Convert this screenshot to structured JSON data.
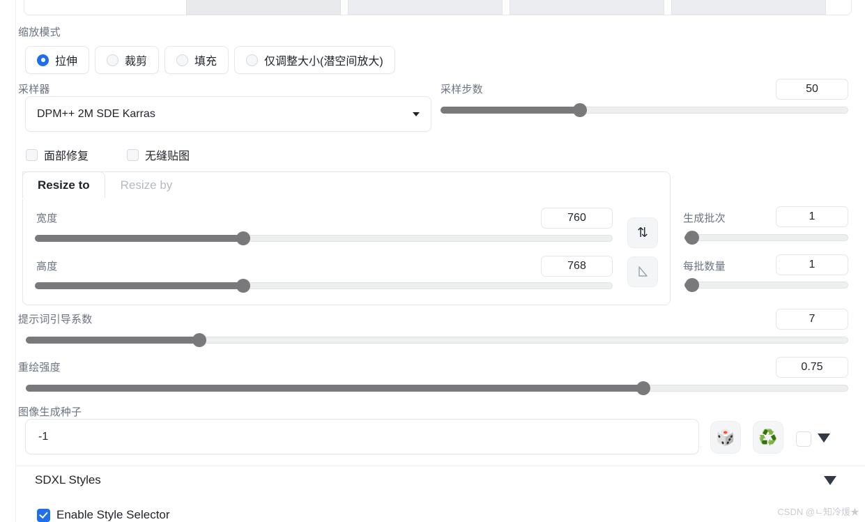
{
  "panel": {
    "resize_mode": {
      "label": "缩放模式",
      "options": [
        {
          "label": "拉伸",
          "selected": true
        },
        {
          "label": "裁剪",
          "selected": false
        },
        {
          "label": "填充",
          "selected": false
        },
        {
          "label": "仅调整大小(潜空间放大)",
          "selected": false
        }
      ]
    },
    "sampler": {
      "label": "采样器",
      "value": "DPM++ 2M SDE Karras",
      "caret_icon": "chevron-down-icon"
    },
    "steps": {
      "label": "采样步数",
      "value": "50",
      "fill_percent": 34
    },
    "toggles": [
      {
        "label": "面部修复",
        "checked": false
      },
      {
        "label": "无缝贴图",
        "checked": false
      }
    ],
    "resize_tabs": [
      {
        "label": "Resize to",
        "active": true
      },
      {
        "label": "Resize by",
        "active": false
      }
    ],
    "width": {
      "label": "宽度",
      "value": "760",
      "fill_percent": 36
    },
    "height": {
      "label": "高度",
      "value": "768",
      "fill_percent": 36
    },
    "swap_button": {
      "icon": "swap-vertical-icon",
      "glyph": "⇅"
    },
    "ratio_button": {
      "icon": "aspect-ratio-triangle-icon"
    },
    "batch_count": {
      "label": "生成批次",
      "value": "1",
      "fill_percent": 0
    },
    "batch_size": {
      "label": "每批数量",
      "value": "1",
      "fill_percent": 0
    },
    "cfg_scale": {
      "label": "提示词引导系数",
      "value": "7",
      "fill_percent": 21
    },
    "denoising": {
      "label": "重绘强度",
      "value": "0.75",
      "fill_percent": 75
    },
    "seed": {
      "label": "图像生成种子",
      "value": "-1",
      "random_button": {
        "icon": "dice-icon",
        "glyph": "🎲"
      },
      "recycle_button": {
        "icon": "recycle-icon",
        "glyph": "♻️"
      },
      "extra_checkbox_checked": false,
      "expand_icon": "triangle-down-icon"
    },
    "sdxl_styles": {
      "title": "SDXL Styles",
      "collapse_icon": "triangle-down-icon",
      "enable_style_selector": {
        "label": "Enable Style Selector",
        "checked": true
      }
    }
  },
  "watermark": "CSDN @ㄴ知冷煖★",
  "colors": {
    "accent": "#1f6feb",
    "slider_fill": "#79797b",
    "slider_track": "#eeefef",
    "border": "#e5e7eb",
    "label_text": "#6b7280",
    "body_text": "#1f2328"
  }
}
